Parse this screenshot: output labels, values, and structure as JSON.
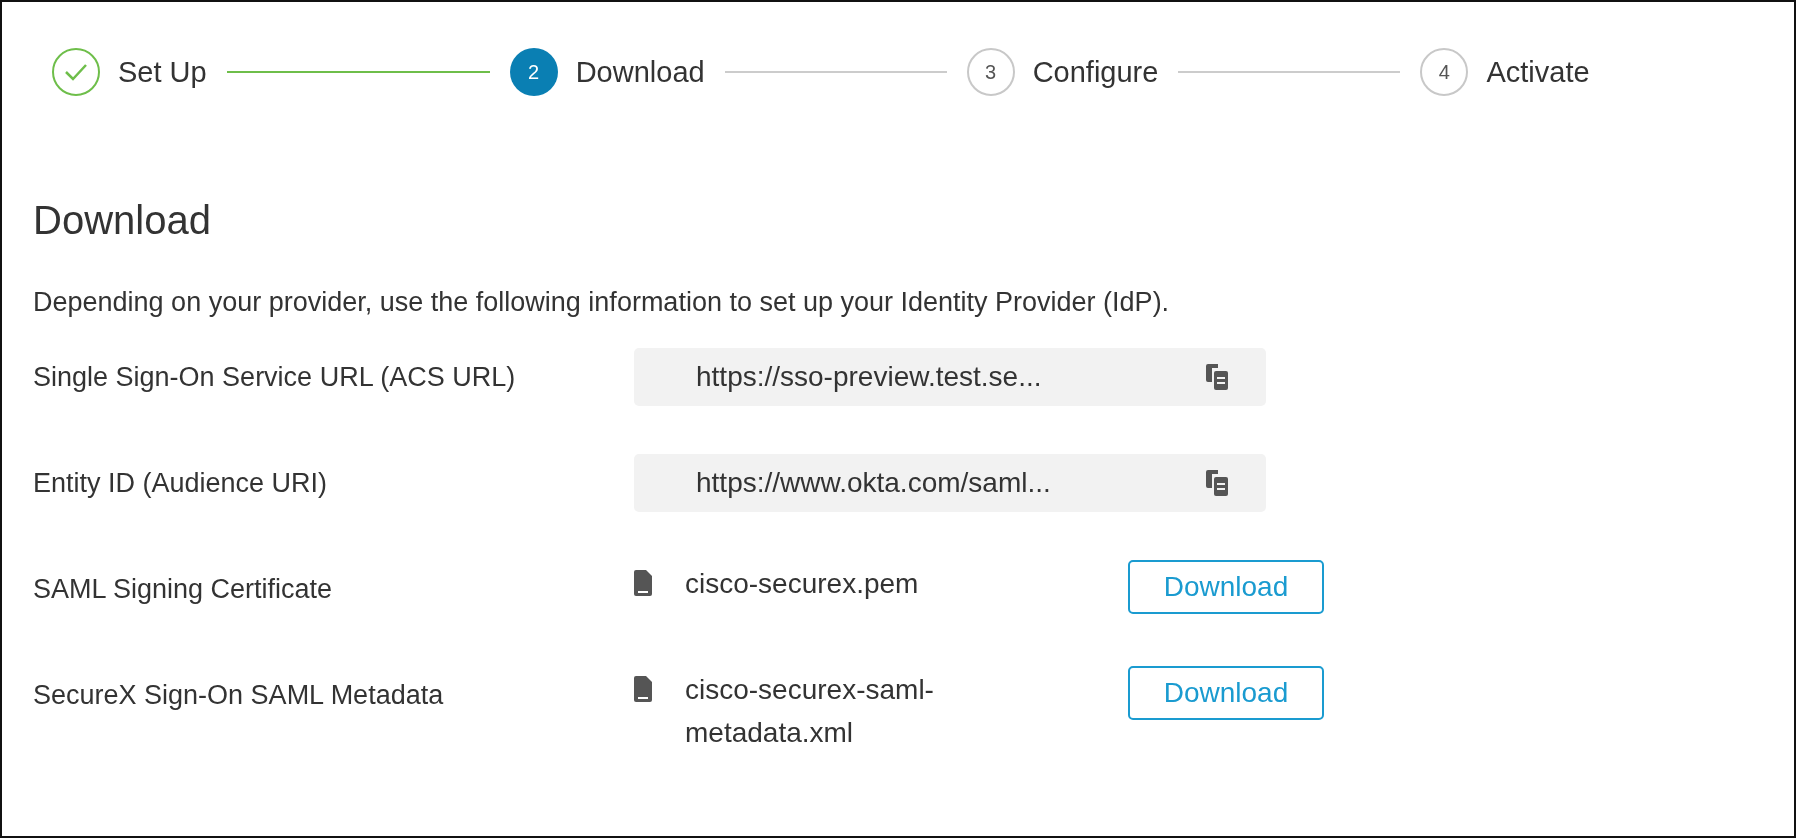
{
  "steps": [
    {
      "label": "Set Up",
      "kind": "done"
    },
    {
      "label": "Download",
      "kind": "current",
      "number": "2"
    },
    {
      "label": "Configure",
      "kind": "upcoming",
      "number": "3"
    },
    {
      "label": "Activate",
      "kind": "upcoming",
      "number": "4"
    }
  ],
  "heading": "Download",
  "intro": "Depending on your provider, use the following information to set up your Identity Provider (IdP).",
  "rows": [
    {
      "kind": "copy",
      "label": "Single Sign-On Service URL (ACS URL)",
      "value": "https://sso-preview.test.se..."
    },
    {
      "kind": "copy",
      "label": "Entity ID (Audience URI)",
      "value": "https://www.okta.com/saml..."
    },
    {
      "kind": "file",
      "label": "SAML Signing Certificate",
      "file": "cisco-securex.pem",
      "button": "Download"
    },
    {
      "kind": "file",
      "label": "SecureX Sign-On SAML Metadata",
      "file": "cisco-securex-saml-metadata.xml",
      "button": "Download"
    }
  ]
}
